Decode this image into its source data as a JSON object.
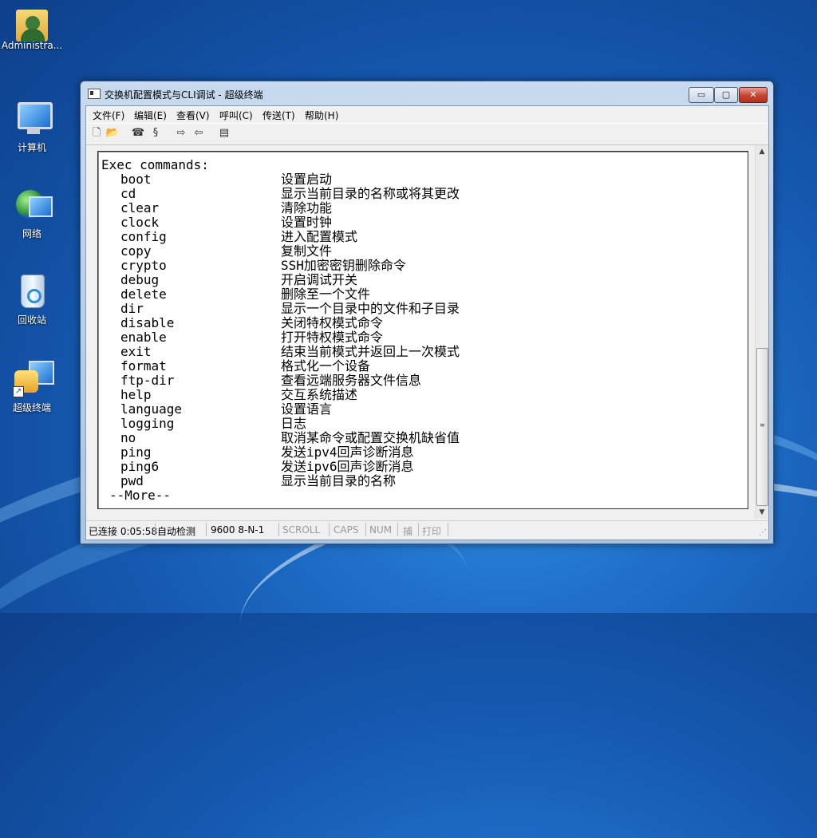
{
  "desktop": {
    "icons": [
      {
        "label": "Administra..."
      },
      {
        "label": "计算机"
      },
      {
        "label": "网络"
      },
      {
        "label": "回收站"
      },
      {
        "label": "超级终端"
      }
    ]
  },
  "window": {
    "title": "交换机配置模式与CLI调试 - 超级终端",
    "controls": {
      "minimize": "▭",
      "maximize": "▢",
      "close": "✕"
    }
  },
  "menu": [
    "文件(F)",
    "编辑(E)",
    "查看(V)",
    "呼叫(C)",
    "传送(T)",
    "帮助(H)"
  ],
  "toolbar": {
    "icons": [
      "new-icon",
      "open-icon",
      "call-icon",
      "disconnect-icon",
      "send-icon",
      "receive-icon",
      "properties-icon"
    ],
    "glyphs": [
      "🗋",
      "📂",
      "☎",
      "§",
      "⇨",
      "⇦",
      "▤"
    ]
  },
  "terminal": {
    "header": "Exec commands:",
    "commands": [
      {
        "cmd": "boot",
        "desc": "设置启动"
      },
      {
        "cmd": "cd",
        "desc": "显示当前目录的名称或将其更改"
      },
      {
        "cmd": "clear",
        "desc": "清除功能"
      },
      {
        "cmd": "clock",
        "desc": "设置时钟"
      },
      {
        "cmd": "config",
        "desc": "进入配置模式"
      },
      {
        "cmd": "copy",
        "desc": "复制文件"
      },
      {
        "cmd": "crypto",
        "desc": "SSH加密密钥删除命令"
      },
      {
        "cmd": "debug",
        "desc": "开启调试开关"
      },
      {
        "cmd": "delete",
        "desc": "删除至一个文件"
      },
      {
        "cmd": "dir",
        "desc": "显示一个目录中的文件和子目录"
      },
      {
        "cmd": "disable",
        "desc": "关闭特权模式命令"
      },
      {
        "cmd": "enable",
        "desc": "打开特权模式命令"
      },
      {
        "cmd": "exit",
        "desc": "结束当前模式并返回上一次模式"
      },
      {
        "cmd": "format",
        "desc": "格式化一个设备"
      },
      {
        "cmd": "ftp-dir",
        "desc": "查看远端服务器文件信息"
      },
      {
        "cmd": "help",
        "desc": "交互系统描述"
      },
      {
        "cmd": "language",
        "desc": "设置语言"
      },
      {
        "cmd": "logging",
        "desc": "日志"
      },
      {
        "cmd": "no",
        "desc": "取消某命令或配置交换机缺省值"
      },
      {
        "cmd": "ping",
        "desc": "发送ipv4回声诊断消息"
      },
      {
        "cmd": "ping6",
        "desc": "发送ipv6回声诊断消息"
      },
      {
        "cmd": "pwd",
        "desc": "显示当前目录的名称"
      }
    ],
    "more": "--More--"
  },
  "status": {
    "connected": "已连接 0:05:58",
    "detect": "自动检测",
    "port": "9600 8-N-1",
    "scroll": "SCROLL",
    "caps": "CAPS",
    "num": "NUM",
    "capture": "捕",
    "print": "打印"
  }
}
